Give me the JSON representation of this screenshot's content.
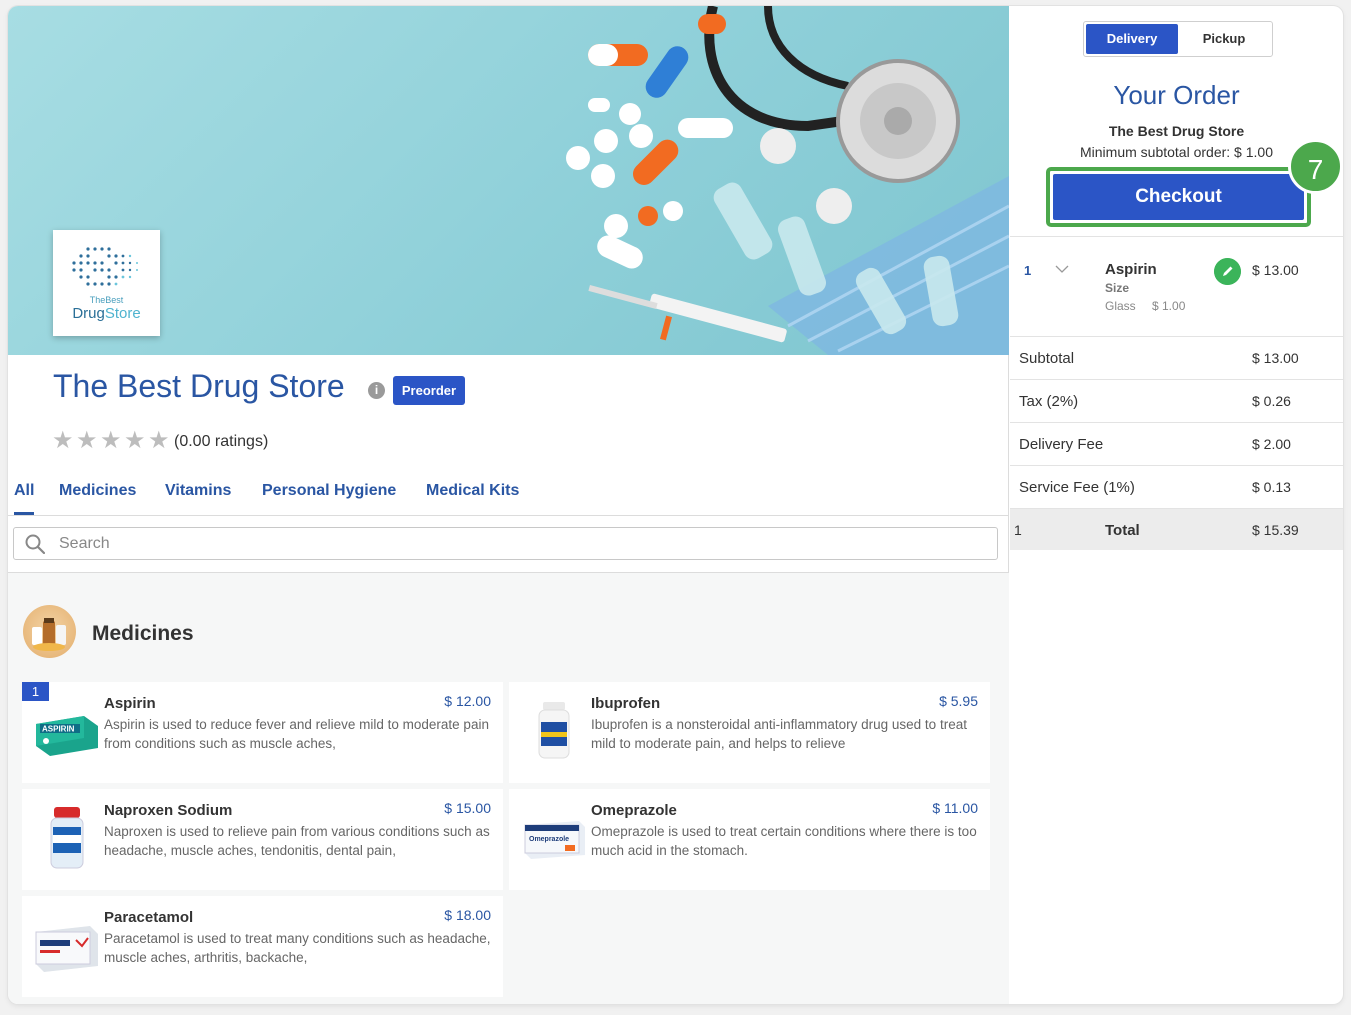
{
  "store": {
    "logo_small": "TheBest",
    "logo_drug": "Drug",
    "logo_store": "Store",
    "title": "The Best Drug Store",
    "badge": "Preorder",
    "rating_text": "(0.00 ratings)",
    "rating_value": 0
  },
  "tabs": [
    "All",
    "Medicines",
    "Vitamins",
    "Personal Hygiene",
    "Medical Kits"
  ],
  "search": {
    "placeholder": "Search"
  },
  "category": {
    "title": "Medicines"
  },
  "products": [
    {
      "name": "Aspirin",
      "price": "$ 12.00",
      "desc": "Aspirin is used to reduce fever and relieve mild to moderate pain from conditions such as muscle aches,",
      "qty": "1"
    },
    {
      "name": "Ibuprofen",
      "price": "$ 5.95",
      "desc": "Ibuprofen is a nonsteroidal anti-inflammatory drug used to treat mild to moderate pain, and helps to relieve"
    },
    {
      "name": "Naproxen Sodium",
      "price": "$ 15.00",
      "desc": "Naproxen is used to relieve pain from various conditions such as headache, muscle aches, tendonitis, dental pain,"
    },
    {
      "name": "Omeprazole",
      "price": "$ 11.00",
      "desc": "Omeprazole is used to treat certain conditions where there is too much acid in the stomach."
    },
    {
      "name": "Paracetamol",
      "price": "$ 18.00",
      "desc": "Paracetamol is used to treat many conditions such as headache, muscle aches, arthritis, backache,"
    }
  ],
  "product_labels": {
    "aspirin_box": "ASPIRIN",
    "omeprazole_box": "Omeprazole"
  },
  "order": {
    "delivery_label": "Delivery",
    "pickup_label": "Pickup",
    "heading": "Your Order",
    "store_name": "The Best Drug Store",
    "min_order": "Minimum subtotal order: $ 1.00",
    "checkout_label": "Checkout",
    "step_number": "7",
    "item": {
      "qty": "1",
      "name": "Aspirin",
      "size_label": "Size",
      "option": "Glass",
      "option_price": "$ 1.00",
      "price": "$ 13.00"
    },
    "summary": [
      {
        "label": "Subtotal",
        "value": "$ 13.00"
      },
      {
        "label": "Tax (2%)",
        "value": "$ 0.26"
      },
      {
        "label": "Delivery Fee",
        "value": "$ 2.00"
      },
      {
        "label": "Service Fee (1%)",
        "value": "$ 0.13"
      }
    ],
    "total": {
      "count": "1",
      "label": "Total",
      "value": "$ 15.39"
    }
  },
  "colors": {
    "brand": "#2b55c6",
    "link": "#2a56a3",
    "highlight": "#4ca84c"
  }
}
